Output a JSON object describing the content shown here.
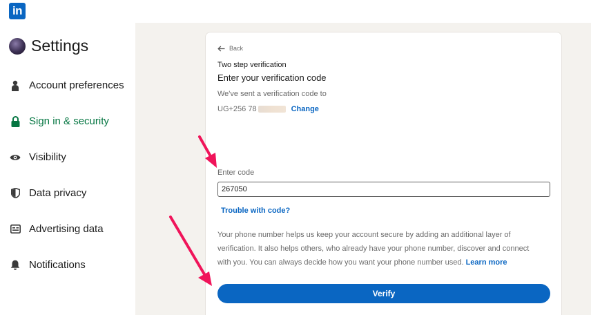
{
  "brand": {
    "logo_text": "in",
    "color": "#0a66c2"
  },
  "sidebar": {
    "title": "Settings",
    "active_color": "#057642",
    "items": [
      {
        "label": "Account preferences",
        "icon": "person-icon",
        "active": false
      },
      {
        "label": "Sign in & security",
        "icon": "lock-icon",
        "active": true
      },
      {
        "label": "Visibility",
        "icon": "eye-icon",
        "active": false
      },
      {
        "label": "Data privacy",
        "icon": "shield-icon",
        "active": false
      },
      {
        "label": "Advertising data",
        "icon": "ad-card-icon",
        "active": false
      },
      {
        "label": "Notifications",
        "icon": "bell-icon",
        "active": false
      }
    ]
  },
  "verification": {
    "back_label": "Back",
    "step_title": "Two step verification",
    "heading": "Enter your verification code",
    "sent_text": "We've sent a verification code to",
    "phone_prefix": "UG+256 78",
    "change_label": "Change",
    "code_label": "Enter code",
    "code_value": "267050",
    "trouble_label": "Trouble with code?",
    "info_text": "Your phone number helps us keep your account secure by adding an additional layer of verification. It also helps others, who already have your phone number, discover and connect with you. You can always decide how you want your phone number used.",
    "learn_more_label": "Learn more",
    "verify_label": "Verify"
  },
  "annotations": {
    "arrow_color": "#f0145a"
  }
}
